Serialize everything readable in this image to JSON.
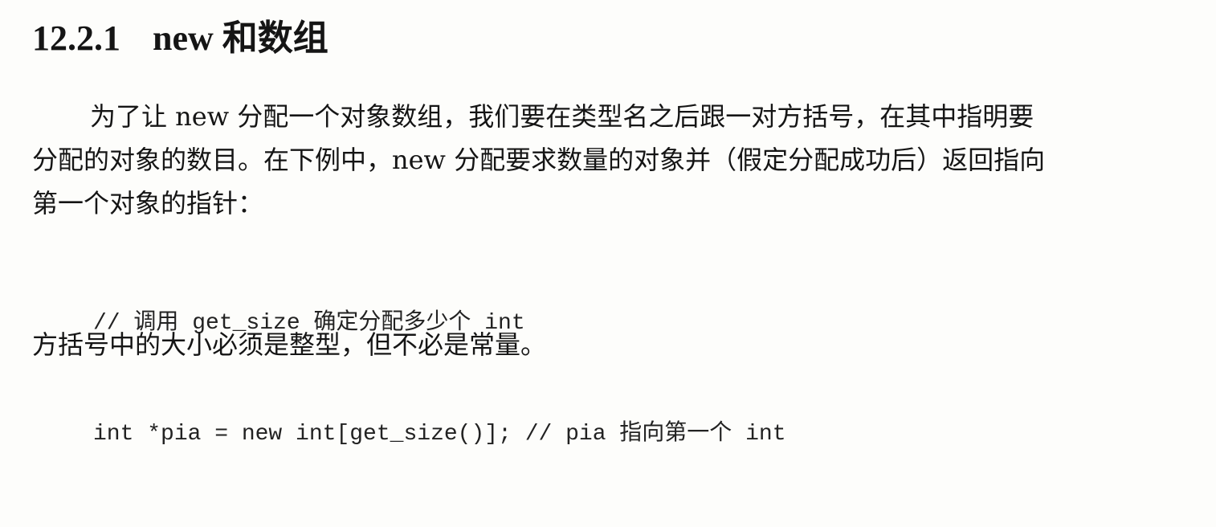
{
  "section": {
    "number": "12.2.1",
    "title": "new 和数组"
  },
  "paragraph": {
    "lines": [
      "为了让 new 分配一个对象数组，我们要在类型名之后跟一对方括号，在其中指明要",
      "分配的对象的数目。在下例中，new 分配要求数量的对象并（假定分配成功后）返回指向",
      "第一个对象的指针："
    ]
  },
  "code": {
    "lines": [
      "// 调用 get_size 确定分配多少个 int",
      "int *pia = new int[get_size()]; // pia 指向第一个 int"
    ]
  },
  "closing": {
    "text": "方括号中的大小必须是整型，但不必是常量。"
  }
}
